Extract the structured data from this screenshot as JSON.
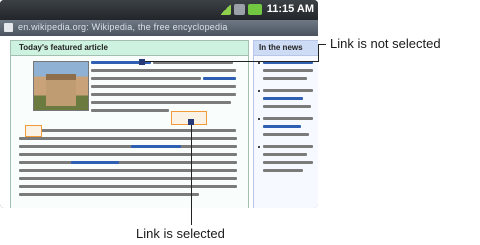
{
  "status_bar": {
    "time": "11:15 AM",
    "icons": [
      "signal-icon",
      "wifi-icon",
      "battery-icon"
    ]
  },
  "address_bar": {
    "url_text": "en.wikipedia.org: Wikipedia, the free encyclopedia"
  },
  "page": {
    "featured_heading": "Today's featured article",
    "news_heading": "In the news"
  },
  "callouts": {
    "top": "Link is not selected",
    "bottom": "Link is selected"
  },
  "colors": {
    "selection_outline": "#f09a3a",
    "link_blue": "#2f5fb3",
    "featured_header": "#cef2e0",
    "news_header": "#cddbf5"
  }
}
